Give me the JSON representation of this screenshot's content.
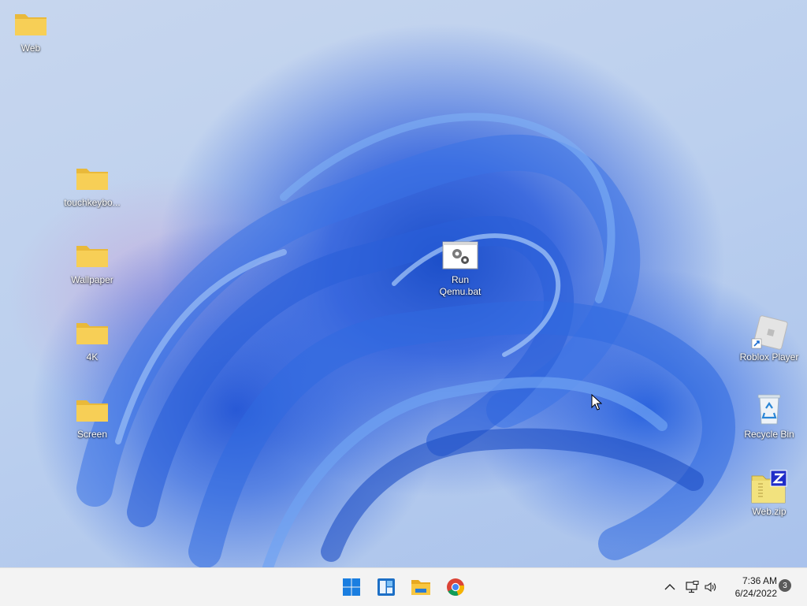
{
  "desktop": {
    "icons": [
      {
        "label": "Web",
        "type": "folder"
      },
      {
        "label": "touchkeybo...",
        "type": "folder"
      },
      {
        "label": "Wallpaper",
        "type": "folder"
      },
      {
        "label": "4K",
        "type": "folder"
      },
      {
        "label": "Screen",
        "type": "folder"
      },
      {
        "label": "Run Qemu.bat",
        "type": "batch-file"
      },
      {
        "label": "Roblox Player",
        "type": "shortcut"
      },
      {
        "label": "Recycle Bin",
        "type": "recycle-bin"
      },
      {
        "label": "Web.zip",
        "type": "zip-archive"
      }
    ]
  },
  "taskbar": {
    "apps": [
      {
        "name": "start-button",
        "icon": "windows-logo-icon"
      },
      {
        "name": "widgets-button",
        "icon": "widgets-icon"
      },
      {
        "name": "file-explorer-button",
        "icon": "folder-icon"
      },
      {
        "name": "chrome-button",
        "icon": "chrome-icon"
      }
    ],
    "tray": {
      "icons": [
        "chevron-up-icon",
        "network-icon",
        "speaker-icon"
      ],
      "time": "7:36 AM",
      "date": "6/24/2022",
      "notification_count": "3"
    }
  },
  "colors": {
    "accent": "#0067c0",
    "folder": "#f7cf56",
    "taskbar": "#f3f3f3"
  }
}
